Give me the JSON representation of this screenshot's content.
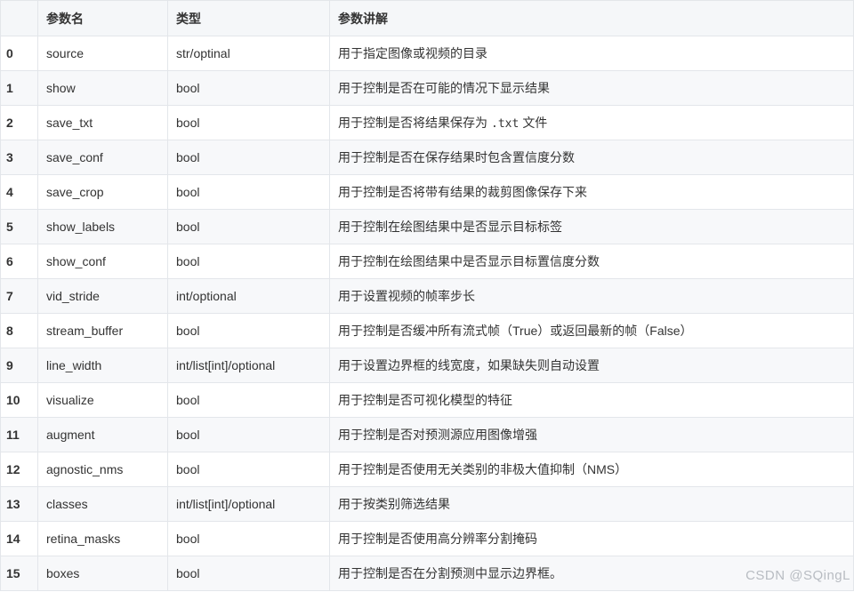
{
  "table": {
    "headers": [
      "",
      "参数名",
      "类型",
      "参数讲解"
    ],
    "rows": [
      {
        "index": "0",
        "name": "source",
        "type": "str/optinal",
        "desc": "用于指定图像或视频的目录"
      },
      {
        "index": "1",
        "name": "show",
        "type": "bool",
        "desc": "用于控制是否在可能的情况下显示结果"
      },
      {
        "index": "2",
        "name": "save_txt",
        "type": "bool",
        "desc_before": "用于控制是否将结果保存为",
        "desc_code": ".txt",
        "desc_after": "文件"
      },
      {
        "index": "3",
        "name": "save_conf",
        "type": "bool",
        "desc": "用于控制是否在保存结果时包含置信度分数"
      },
      {
        "index": "4",
        "name": "save_crop",
        "type": "bool",
        "desc": "用于控制是否将带有结果的裁剪图像保存下来"
      },
      {
        "index": "5",
        "name": "show_labels",
        "type": "bool",
        "desc": "用于控制在绘图结果中是否显示目标标签"
      },
      {
        "index": "6",
        "name": "show_conf",
        "type": "bool",
        "desc": "用于控制在绘图结果中是否显示目标置信度分数"
      },
      {
        "index": "7",
        "name": "vid_stride",
        "type": "int/optional",
        "desc": "用于设置视频的帧率步长"
      },
      {
        "index": "8",
        "name": "stream_buffer",
        "type": "bool",
        "desc": "用于控制是否缓冲所有流式帧（True）或返回最新的帧（False）"
      },
      {
        "index": "9",
        "name": "line_width",
        "type": "int/list[int]/optional",
        "desc": "用于设置边界框的线宽度，如果缺失则自动设置"
      },
      {
        "index": "10",
        "name": "visualize",
        "type": "bool",
        "desc": "用于控制是否可视化模型的特征"
      },
      {
        "index": "11",
        "name": "augment",
        "type": "bool",
        "desc": "用于控制是否对预测源应用图像增强"
      },
      {
        "index": "12",
        "name": "agnostic_nms",
        "type": "bool",
        "desc": "用于控制是否使用无关类别的非极大值抑制（NMS）"
      },
      {
        "index": "13",
        "name": "classes",
        "type": "int/list[int]/optional",
        "desc": "用于按类别筛选结果"
      },
      {
        "index": "14",
        "name": "retina_masks",
        "type": "bool",
        "desc": "用于控制是否使用高分辨率分割掩码"
      },
      {
        "index": "15",
        "name": "boxes",
        "type": "bool",
        "desc": "用于控制是否在分割预测中显示边界框。"
      }
    ]
  },
  "watermark": "CSDN @SQingL"
}
